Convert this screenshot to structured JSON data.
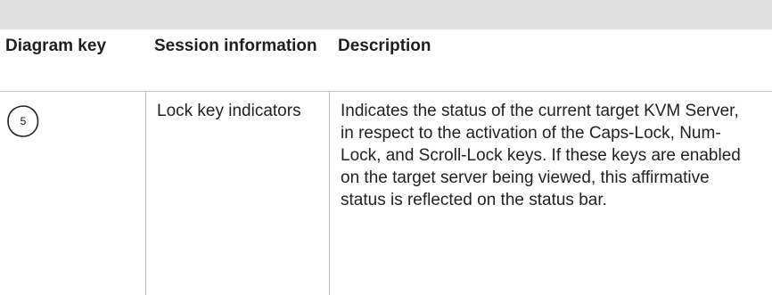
{
  "table": {
    "headers": {
      "diagram_key": "Diagram key",
      "session_information": "Session information",
      "description": "Description"
    },
    "rows": [
      {
        "diagram_key_number": "5",
        "session_information": "Lock key indicators",
        "description": "Indicates the status of the current target KVM Server, in respect to the activation of the Caps-Lock, Num-Lock, and Scroll-Lock keys. If these keys are enabled on the target server being viewed, this affirmative status is reflected on the status bar."
      }
    ]
  },
  "colors": {
    "header_band": "#e0e0e0",
    "text": "#1f1f1f",
    "rule": "#c7c7c7"
  }
}
